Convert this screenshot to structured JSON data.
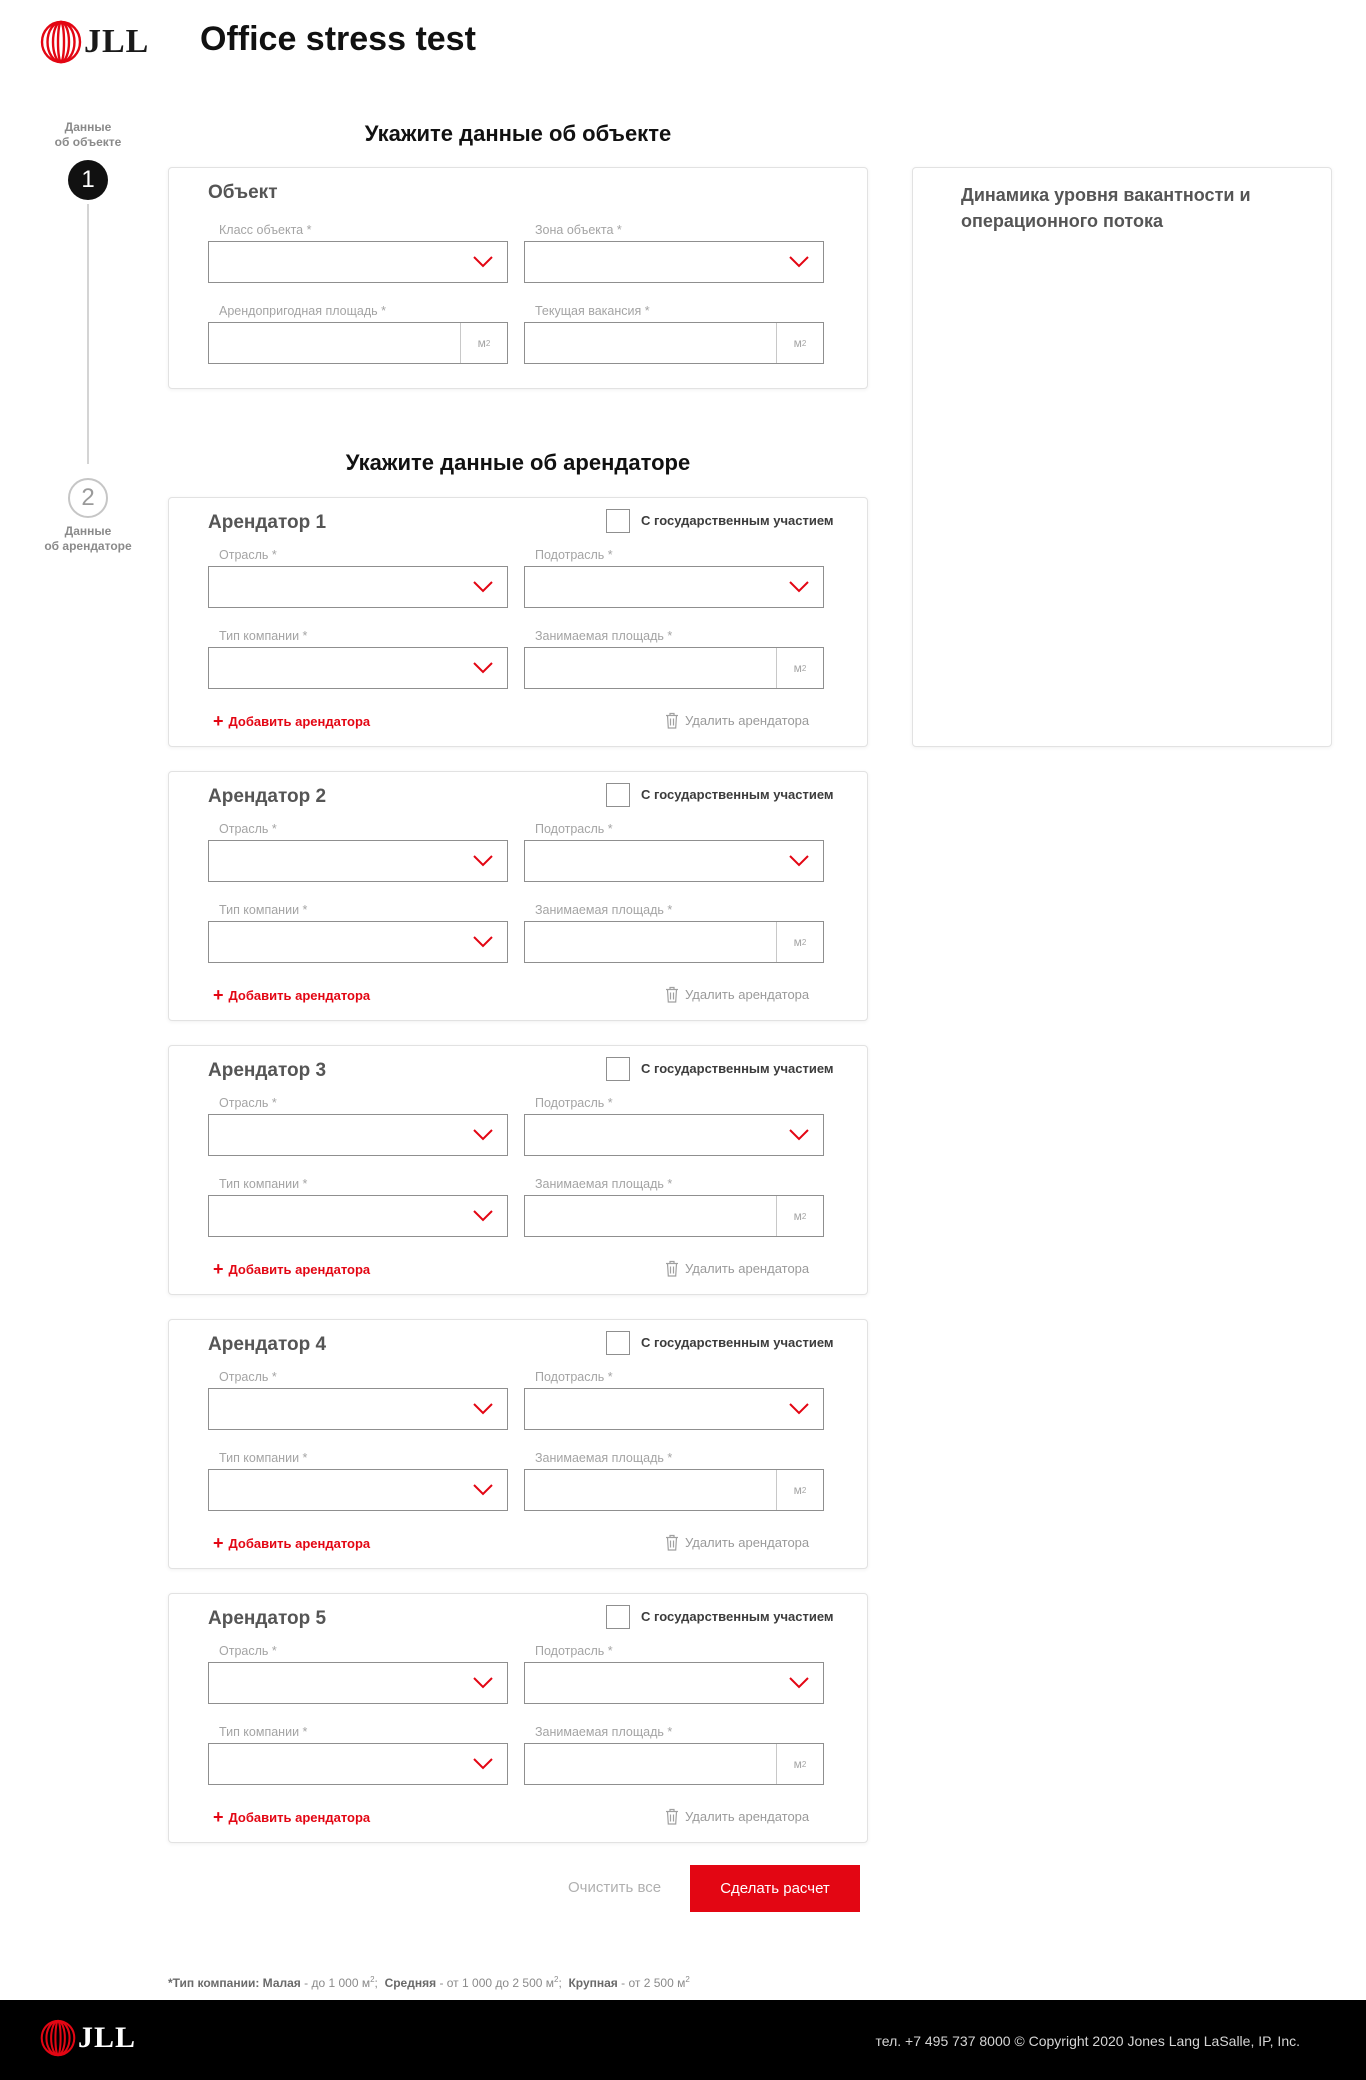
{
  "header": {
    "logo_text": "JLL",
    "title": "Office stress test"
  },
  "stepper": {
    "steps": [
      {
        "number": "1",
        "label_line1": "Данные",
        "label_line2": "об объекте",
        "active": true
      },
      {
        "number": "2",
        "label_line1": "Данные",
        "label_line2": "об арендаторе",
        "active": false
      }
    ]
  },
  "object_section": {
    "heading": "Укажите данные об объекте",
    "card_title": "Объект",
    "class_label": "Класс объекта *",
    "zone_label": "Зона объекта *",
    "area_label": "Арендопригодная площадь *",
    "vacancy_label": "Текущая вакансия *",
    "unit": "м",
    "unit_sup": "2"
  },
  "tenant_section": {
    "heading": "Укажите данные об арендаторе",
    "state_checkbox_label": "С государственным участием",
    "industry_label": "Отрасль *",
    "subindustry_label": "Подотрасль *",
    "company_type_label": "Тип компании *",
    "occupied_area_label": "Занимаемая площадь *",
    "unit": "м",
    "unit_sup": "2",
    "add_label": "Добавить арендатора",
    "delete_label": "Удалить арендатора",
    "tenants": [
      {
        "title": "Арендатор 1"
      },
      {
        "title": "Арендатор 2"
      },
      {
        "title": "Арендатор 3"
      },
      {
        "title": "Арендатор 4"
      },
      {
        "title": "Арендатор 5"
      }
    ]
  },
  "side_panel": {
    "title": "Динамика уровня вакантности и операционного потока"
  },
  "actions": {
    "clear_label": "Очистить все",
    "calculate_label": "Сделать расчет"
  },
  "footnote": {
    "prefix": "*Тип компании:",
    "small_label": "Малая",
    "small_text": " - до 1 000 м",
    "medium_label": "Средняя",
    "medium_text": " - от 1 000 до 2 500 м",
    "large_label": "Крупная",
    "large_text": " - от 2 500 м",
    "sup": "2"
  },
  "footer": {
    "logo_text": "JLL",
    "text": "тел. +7 495 737 8000 © Copyright 2020 Jones Lang LaSalle, IP, Inc."
  },
  "colors": {
    "accent": "#e30613",
    "footer_bg": "#000000"
  }
}
